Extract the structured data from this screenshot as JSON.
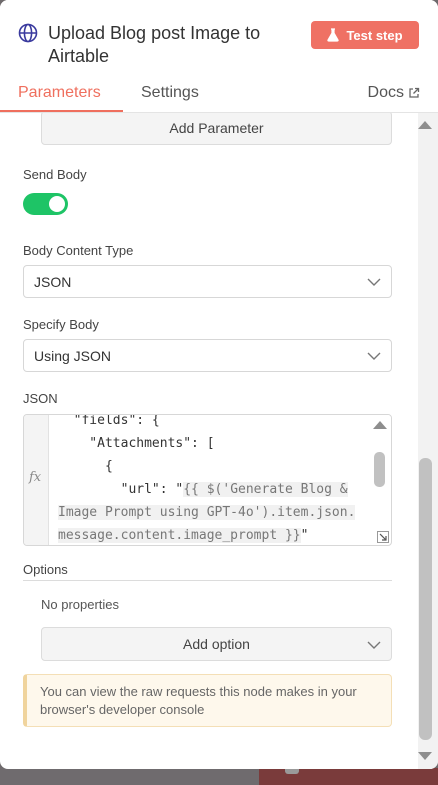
{
  "header": {
    "title": "Upload Blog post Image to Airtable",
    "test_button_label": "Test step"
  },
  "tabs": [
    {
      "label": "Parameters",
      "active": true
    },
    {
      "label": "Settings",
      "active": false
    }
  ],
  "docs_label": "Docs",
  "add_parameter_label": "Add Parameter",
  "send_body": {
    "label": "Send Body",
    "enabled": true
  },
  "body_content_type": {
    "label": "Body Content Type",
    "value": "JSON"
  },
  "specify_body": {
    "label": "Specify Body",
    "value": "Using JSON"
  },
  "json_field": {
    "label": "JSON",
    "lines": {
      "l0": "  \"fields\": {",
      "l1": "    \"Attachments\": [",
      "l2": "      {",
      "l3_key": "        \"url\": \"",
      "l3_expr": "{{ $('Generate Blog &",
      "l4_expr": "Image Prompt using GPT-4o').item.json.",
      "l5_expr": "message.content.image_prompt }}",
      "l5_tail": "\"",
      "l6": "      }"
    }
  },
  "options": {
    "label": "Options",
    "empty_text": "No properties",
    "add_option_label": "Add option"
  },
  "notice_text": "You can view the raw requests this node makes in your browser's developer console",
  "colors": {
    "accent": "#ef6f5e",
    "toggle_on": "#1ec466",
    "notice_bg": "#fef8ec"
  }
}
